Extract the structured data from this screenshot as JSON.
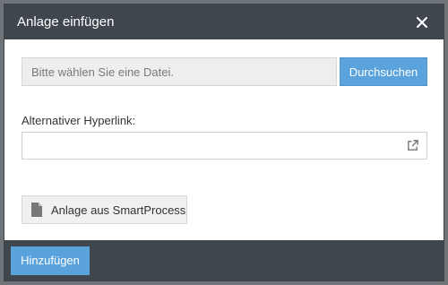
{
  "dialog": {
    "title": "Anlage einfügen",
    "close_icon": "close-icon"
  },
  "file": {
    "placeholder": "Bitte wählen Sie eine Datei.",
    "browse_label": "Durchsuchen"
  },
  "hyperlink": {
    "label": "Alternativer Hyperlink:",
    "value": "",
    "icon": "external-link-icon"
  },
  "smartprocess": {
    "icon": "document-icon",
    "label": "Anlage aus SmartProcess"
  },
  "footer": {
    "add_label": "Hinzufügen"
  },
  "colors": {
    "header_bg": "#3f464d",
    "accent": "#5aa3dc",
    "file_field_bg": "#eeeeee"
  }
}
